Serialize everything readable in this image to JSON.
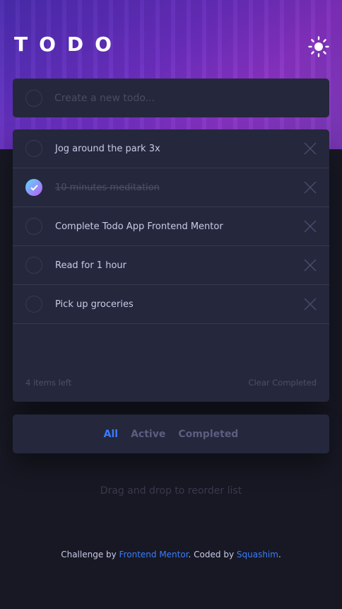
{
  "header": {
    "logo": "TODO",
    "theme_toggle_icon": "sun-icon"
  },
  "new_todo": {
    "placeholder": "Create a new todo..."
  },
  "todos": [
    {
      "label": "Jog around the park 3x",
      "completed": false
    },
    {
      "label": "10 minutes meditation",
      "completed": true
    },
    {
      "label": "Complete Todo App Frontend Mentor",
      "completed": false
    },
    {
      "label": "Read for 1 hour",
      "completed": false
    },
    {
      "label": "Pick up groceries",
      "completed": false
    }
  ],
  "footer": {
    "items_left": "4 items left",
    "clear_completed": "Clear Completed"
  },
  "filters": {
    "all": "All",
    "active": "Active",
    "completed": "Completed",
    "selected": "All"
  },
  "drag_hint": "Drag and drop to reorder list",
  "credit": {
    "prefix": "Challenge by ",
    "frontend_mentor": "Frontend Mentor",
    "middle": ". Coded by ",
    "author": "Squashim",
    "suffix": "."
  },
  "colors": {
    "background": "#171823",
    "card": "#25273d",
    "accent": "#3a7cfd",
    "check_gradient_start": "#55ddff",
    "check_gradient_end": "#c058f3"
  }
}
